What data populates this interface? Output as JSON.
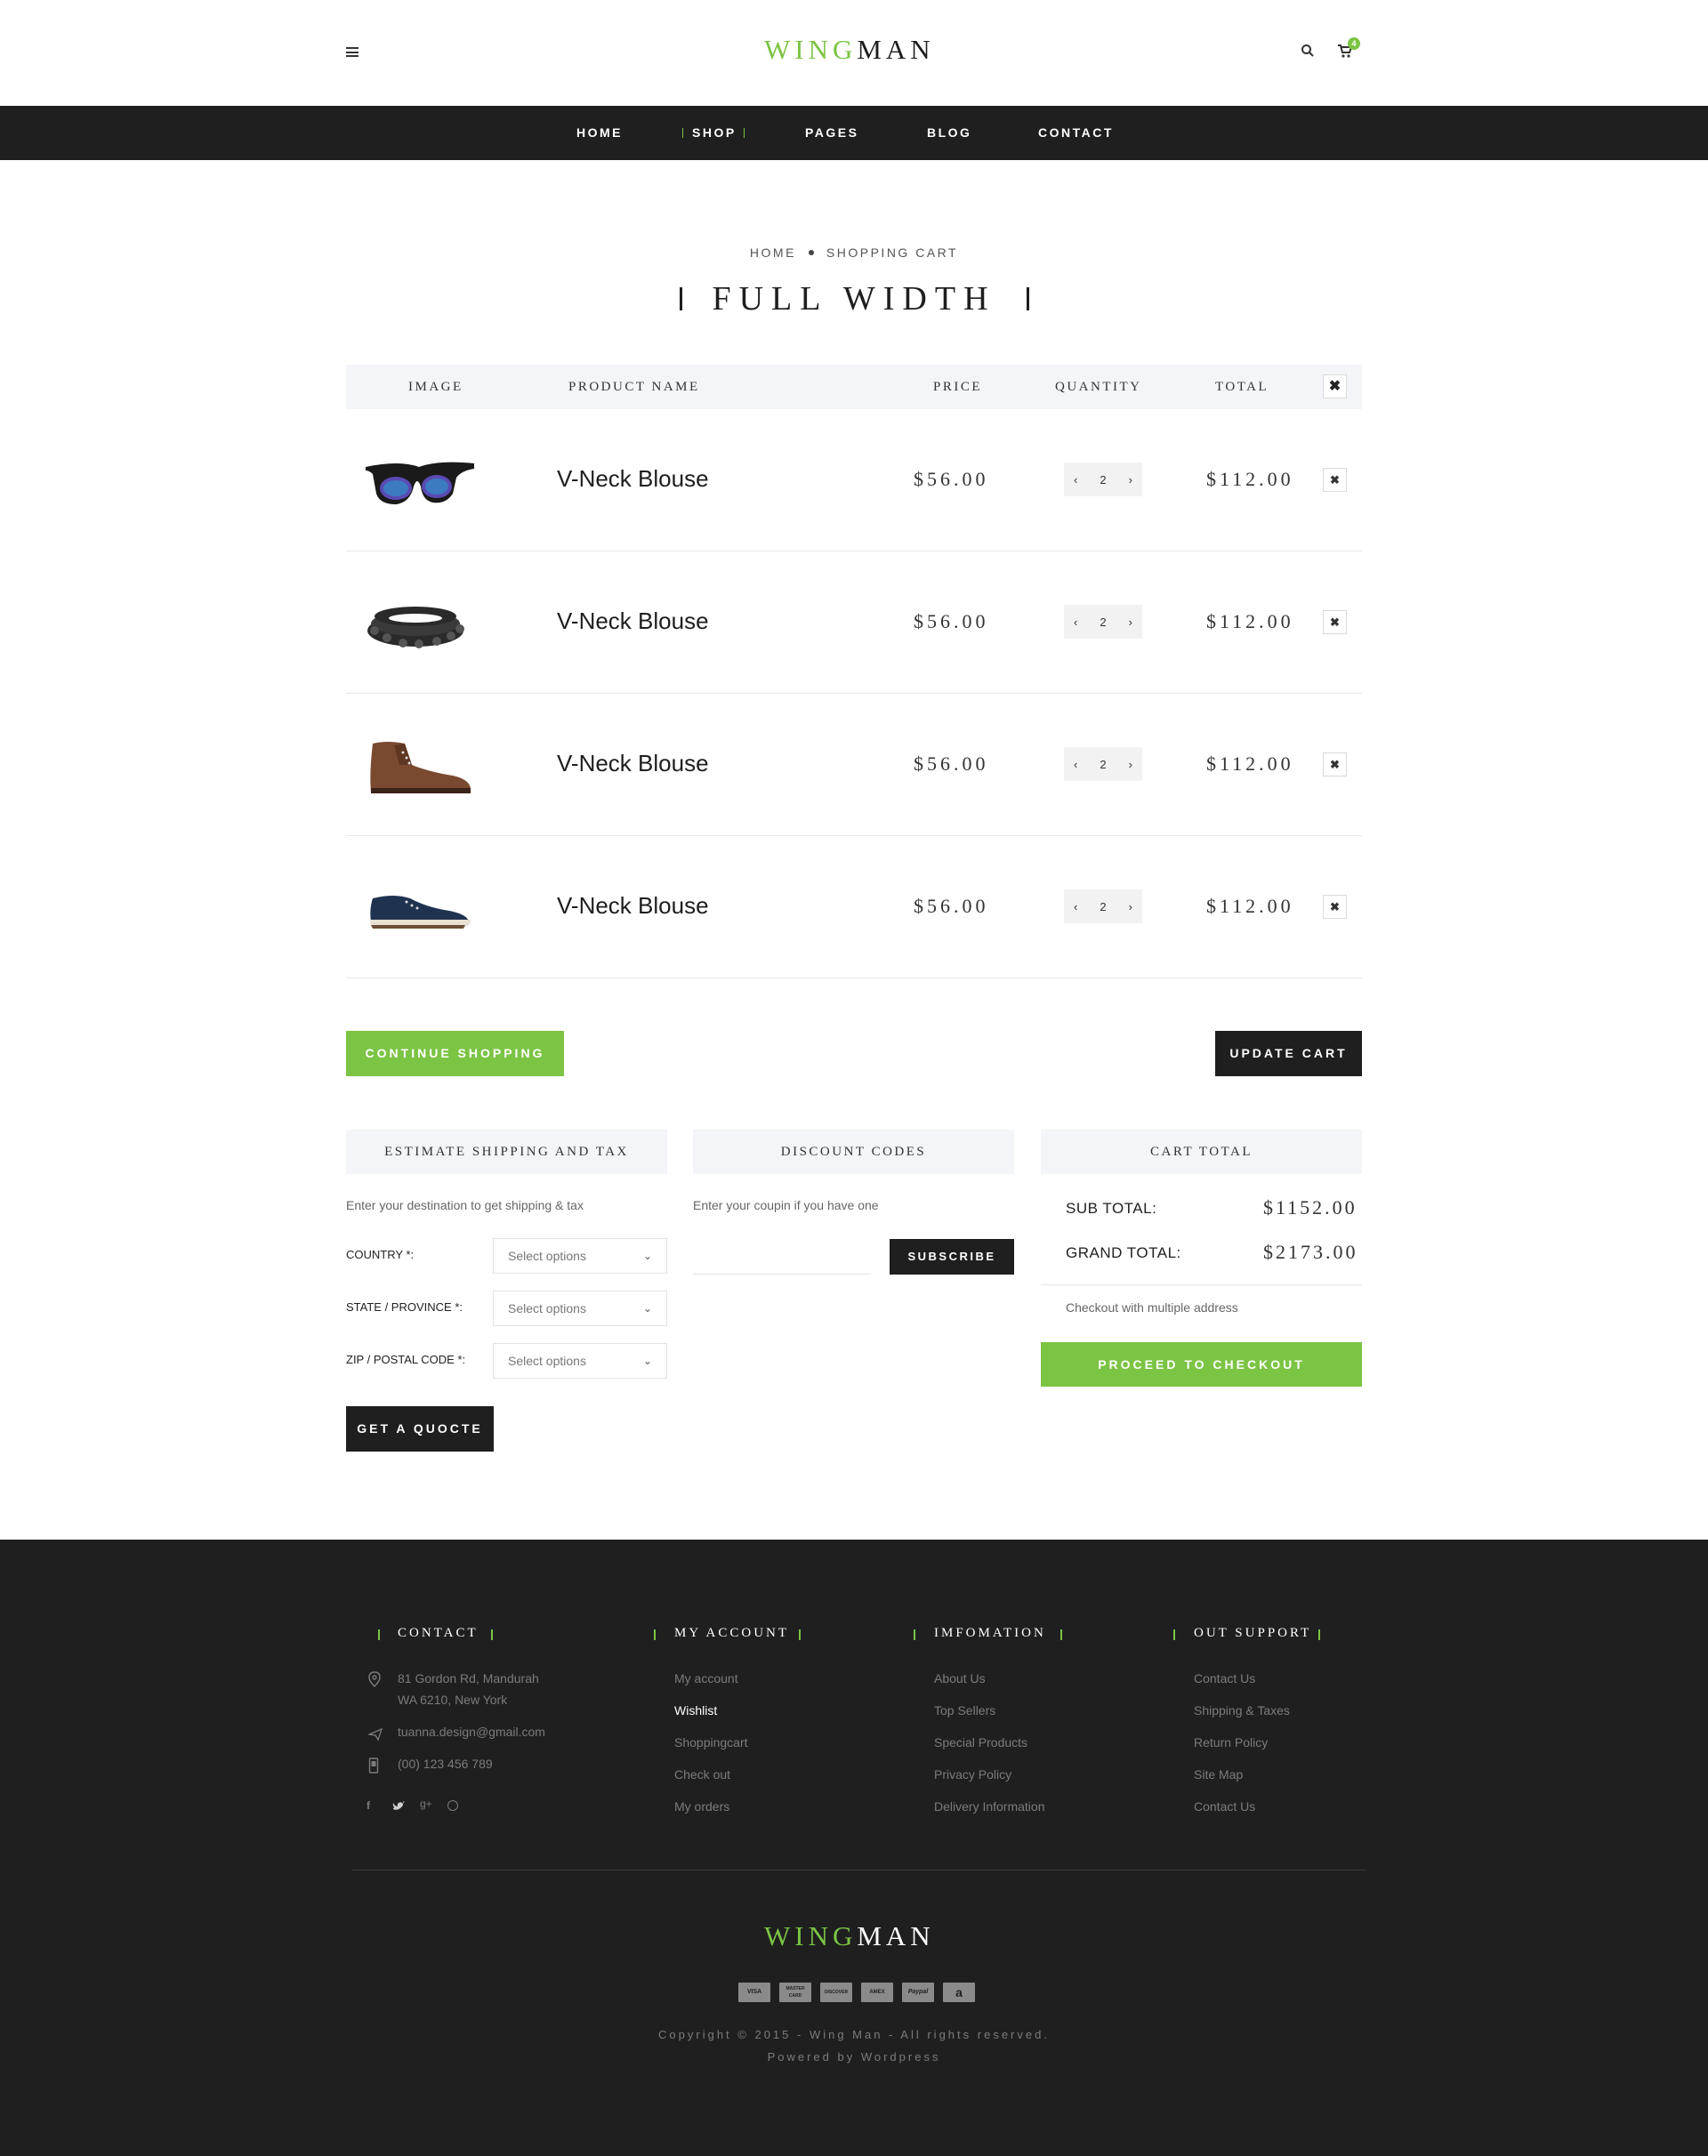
{
  "header": {
    "logo_part1": "WING",
    "logo_part2": "MAN",
    "cart_count": "4",
    "icons": [
      "menu-icon",
      "search-icon",
      "cart-icon"
    ]
  },
  "nav": {
    "items": [
      "HOME",
      "SHOP",
      "PAGES",
      "BLOG",
      "CONTACT"
    ],
    "active": "SHOP"
  },
  "breadcrumb": {
    "home": "HOME",
    "current": "SHOPPING CART"
  },
  "page_title": "FULL WIDTH",
  "cart": {
    "headers": {
      "image": "IMAGE",
      "product": "PRODUCT NAME",
      "price": "PRICE",
      "quantity": "QUANTITY",
      "total": "TOTAL"
    },
    "items": [
      {
        "image": "sunglasses",
        "name": "V-Neck Blouse",
        "price": "$56.00",
        "qty": "2",
        "total": "$112.00"
      },
      {
        "image": "bracelet",
        "name": "V-Neck Blouse",
        "price": "$56.00",
        "qty": "2",
        "total": "$112.00"
      },
      {
        "image": "brown-boot",
        "name": "V-Neck Blouse",
        "price": "$56.00",
        "qty": "2",
        "total": "$112.00"
      },
      {
        "image": "navy-sneaker",
        "name": "V-Neck Blouse",
        "price": "$56.00",
        "qty": "2",
        "total": "$112.00"
      }
    ],
    "qty_decrease": "‹",
    "qty_increase": "›",
    "remove": "✖"
  },
  "actions": {
    "continue": "CONTINUE SHOPPING",
    "update": "UPDATE CART"
  },
  "shipping": {
    "title": "ESTIMATE SHIPPING AND TAX",
    "intro": "Enter your destination to get shipping & tax",
    "fields": [
      {
        "label": "COUNTRY *:",
        "value": "Select options"
      },
      {
        "label": "STATE / PROVINCE *:",
        "value": "Select options"
      },
      {
        "label": "ZIP / POSTAL CODE *:",
        "value": "Select options"
      }
    ],
    "button": "GET A QUOCTE"
  },
  "discount": {
    "title": "DISCOUNT CODES",
    "intro": "Enter your coupin if you have one",
    "input_value": "",
    "button": "SUBSCRIBE"
  },
  "totals": {
    "title": "CART TOTAL",
    "sub_label": "SUB TOTAL:",
    "sub_value": "$1152.00",
    "grand_label": "GRAND TOTAL:",
    "grand_value": "$2173.00",
    "multi": "Checkout with multiple address",
    "checkout": "PROCEED TO CHECKOUT"
  },
  "footer": {
    "contact": {
      "title": "CONTACT",
      "address_line1": "81 Gordon Rd, Mandurah",
      "address_line2": "WA 6210, New York",
      "email": "tuanna.design@gmail.com",
      "phone": "(00) 123 456 789",
      "social": [
        "facebook-icon",
        "twitter-icon",
        "google-plus-icon",
        "pinterest-icon"
      ]
    },
    "account": {
      "title": "MY ACCOUNT",
      "links": [
        "My account",
        "Wishlist",
        "Shoppingcart",
        "Check out",
        "My orders"
      ],
      "highlight": "Wishlist"
    },
    "information": {
      "title": "IMFOMATION",
      "links": [
        "About Us",
        "Top Sellers",
        "Special Products",
        "Privacy Policy",
        "Delivery Information"
      ]
    },
    "support": {
      "title": "OUT SUPPORT",
      "links": [
        "Contact Us",
        "Shipping & Taxes",
        "Return Policy",
        "Site Map",
        "Contact Us"
      ]
    },
    "logo_part1": "WING",
    "logo_part2": "MAN",
    "payments": [
      "VISA",
      "MASTER CARD",
      "DISCOVER",
      "AMEX",
      "Paypal",
      "a"
    ],
    "copyright": "Copyright © 2015 - Wing Man - All rights reserved.",
    "powered": "Powered by Wordpress"
  },
  "colors": {
    "accent": "#7cc444",
    "dark": "#1f1f1f",
    "panel": "#f4f5f8"
  }
}
